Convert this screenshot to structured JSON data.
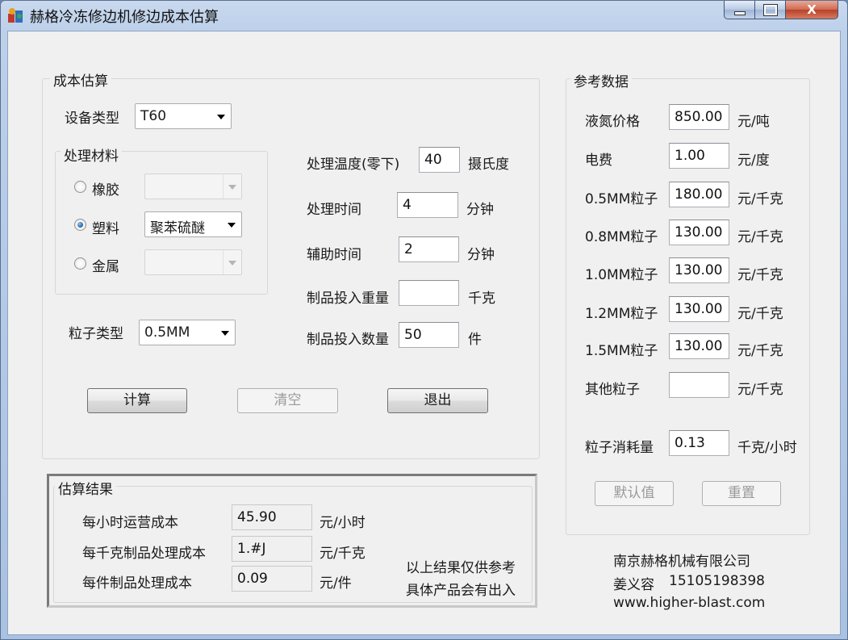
{
  "window": {
    "title": "赫格冷冻修边机修边成本估算",
    "close_glyph": "X"
  },
  "cost_group": {
    "title": "成本估算",
    "equipment": {
      "label": "设备类型",
      "value": "T60"
    },
    "material_group": {
      "title": "处理材料",
      "options": [
        {
          "label": "橡胶",
          "checked": false,
          "combo_value": ""
        },
        {
          "label": "塑料",
          "checked": true,
          "combo_value": "聚苯硫醚"
        },
        {
          "label": "金属",
          "checked": false,
          "combo_value": ""
        }
      ]
    },
    "particle": {
      "label": "粒子类型",
      "value": "0.5MM"
    },
    "temperature": {
      "label": "处理温度(零下)",
      "value": "40",
      "unit": "摄氏度"
    },
    "process_time": {
      "label": "处理时间",
      "value": "4",
      "unit": "分钟"
    },
    "aux_time": {
      "label": "辅助时间",
      "value": "2",
      "unit": "分钟"
    },
    "input_weight": {
      "label": "制品投入重量",
      "value": "",
      "unit": "千克"
    },
    "input_count": {
      "label": "制品投入数量",
      "value": "50",
      "unit": "件"
    },
    "buttons": {
      "calculate": "计算",
      "clear": "清空",
      "exit": "退出"
    }
  },
  "result_group": {
    "title": "估算结果",
    "rows": [
      {
        "label": "每小时运营成本",
        "value": "45.90",
        "unit": "元/小时"
      },
      {
        "label": "每千克制品处理成本",
        "value": "1.#J",
        "unit": "元/千克"
      },
      {
        "label": "每件制品处理成本",
        "value": "0.09",
        "unit": "元/件"
      }
    ],
    "note_line1": "以上结果仅供参考",
    "note_line2": "具体产品会有出入"
  },
  "reference_group": {
    "title": "参考数据",
    "rows": [
      {
        "label": "液氮价格",
        "value": "850.00",
        "unit": "元/吨"
      },
      {
        "label": "电费",
        "value": "1.00",
        "unit": "元/度"
      },
      {
        "label": "0.5MM粒子",
        "value": "180.00",
        "unit": "元/千克"
      },
      {
        "label": "0.8MM粒子",
        "value": "130.00",
        "unit": "元/千克"
      },
      {
        "label": "1.0MM粒子",
        "value": "130.00",
        "unit": "元/千克"
      },
      {
        "label": "1.2MM粒子",
        "value": "130.00",
        "unit": "元/千克"
      },
      {
        "label": "1.5MM粒子",
        "value": "130.00",
        "unit": "元/千克"
      },
      {
        "label": "其他粒子",
        "value": "",
        "unit": "元/千克"
      }
    ],
    "consumption": {
      "label": "粒子消耗量",
      "value": "0.13",
      "unit": "千克/小时"
    },
    "buttons": {
      "default": "默认值",
      "reset": "重置"
    }
  },
  "company": {
    "name": "南京赫格机械有限公司",
    "contact_name": "姜义容",
    "phone": "15105198398",
    "website": "www.higher-blast.com"
  }
}
